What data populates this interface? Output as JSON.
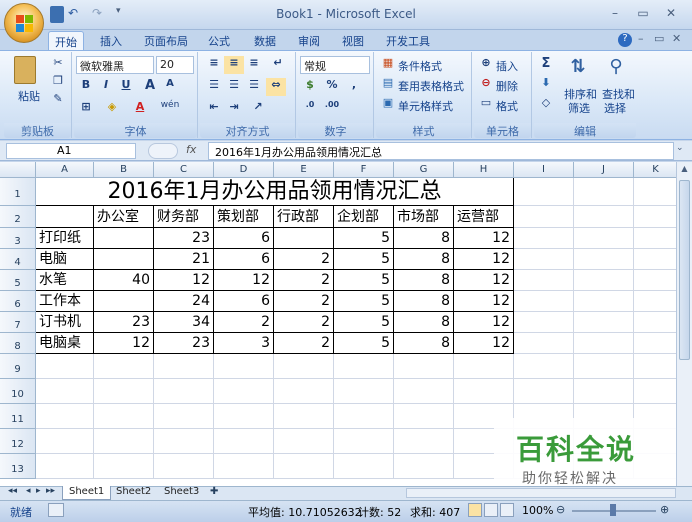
{
  "window": {
    "title": "Book1 - Microsoft Excel",
    "controls": [
      "–",
      "▭",
      "✕"
    ]
  },
  "ribbon": {
    "tabs": [
      "开始",
      "插入",
      "页面布局",
      "公式",
      "数据",
      "审阅",
      "视图",
      "开发工具"
    ],
    "active_tab": "开始",
    "groups": {
      "clipboard": {
        "label": "剪贴板",
        "paste": "粘贴"
      },
      "font": {
        "label": "字体",
        "font_name": "微软雅黑",
        "font_size": "20",
        "bold": "B",
        "italic": "I",
        "underline": "U",
        "grow": "A",
        "shrink": "A",
        "wen": "wén"
      },
      "alignment": {
        "label": "对齐方式"
      },
      "number": {
        "label": "数字",
        "format": "常规",
        "percent": "%",
        "comma": ","
      },
      "styles": {
        "label": "样式",
        "conditional": "条件格式",
        "table": "套用表格格式",
        "cell_styles": "单元格样式"
      },
      "cells": {
        "label": "单元格",
        "insert": "插入",
        "delete": "删除",
        "format": "格式"
      },
      "editing": {
        "label": "编辑",
        "sort": "排序和",
        "filter": "筛选",
        "find": "查找和",
        "select": "选择",
        "sigma": "Σ"
      }
    }
  },
  "formula_bar": {
    "name_box": "A1",
    "fx": "fx",
    "content": "2016年1月办公用品领用情况汇总"
  },
  "grid": {
    "columns": [
      "A",
      "B",
      "C",
      "D",
      "E",
      "F",
      "G",
      "H",
      "I",
      "J",
      "K"
    ],
    "rows": [
      "1",
      "2",
      "3",
      "4",
      "5",
      "6",
      "7",
      "8",
      "9",
      "10",
      "11",
      "12",
      "13"
    ],
    "title": "2016年1月办公用品领用情况汇总",
    "headers": [
      "",
      "办公室",
      "财务部",
      "策划部",
      "行政部",
      "企划部",
      "市场部",
      "运营部"
    ],
    "data": [
      [
        "打印纸",
        "",
        "23",
        "6",
        "",
        "5",
        "8",
        "12"
      ],
      [
        "电脑",
        "",
        "21",
        "6",
        "2",
        "5",
        "8",
        "12"
      ],
      [
        "水笔",
        "40",
        "12",
        "12",
        "2",
        "5",
        "8",
        "12"
      ],
      [
        "工作本",
        "",
        "24",
        "6",
        "2",
        "5",
        "8",
        "12"
      ],
      [
        "订书机",
        "23",
        "34",
        "2",
        "2",
        "5",
        "8",
        "12"
      ],
      [
        "电脑桌",
        "12",
        "23",
        "3",
        "2",
        "5",
        "8",
        "12"
      ]
    ]
  },
  "sheets": {
    "tabs": [
      "Sheet1",
      "Sheet2",
      "Sheet3"
    ],
    "active": "Sheet1"
  },
  "status": {
    "ready": "就绪",
    "average": "平均值: 10.71052632",
    "count": "计数: 52",
    "sum": "求和: 407",
    "zoom": "100%"
  },
  "watermark": {
    "title": "百科全说",
    "subtitle": "助你轻松解决"
  },
  "colors": {
    "accent": "#15428b",
    "ribbon_bg": "#dbe8f7",
    "watermark_green": "#3a9b3a"
  }
}
